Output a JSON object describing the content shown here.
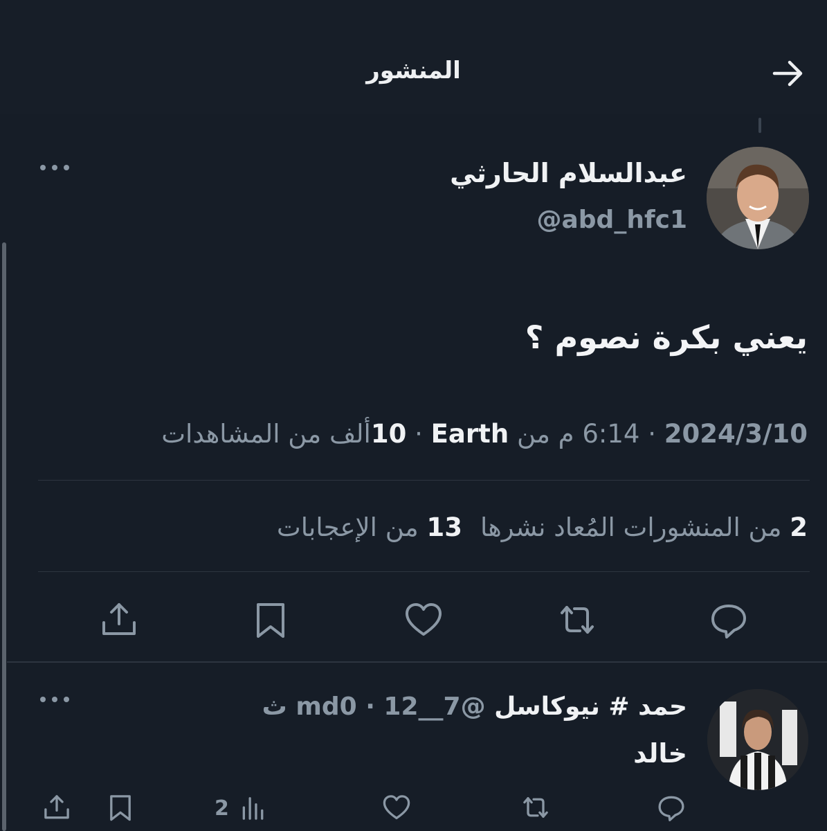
{
  "header": {
    "title": "المنشور",
    "back_icon": "arrow-right-icon"
  },
  "tweet": {
    "author_name": "عبدالسلام الحارثي",
    "author_handle": "@abd_hfc1",
    "text": "يعني بكرة نصوم ؟",
    "meta": {
      "date": "2024/3/10",
      "separator": "·",
      "time": "6:14 م من",
      "location": "Earth",
      "views_count": "10",
      "views_label": "ألف من المشاهدات"
    },
    "stats": {
      "reposts_count": "2",
      "reposts_label": "من المنشورات المُعاد نشرها",
      "likes_count": "13",
      "likes_label": "من الإعجابات"
    },
    "actions": [
      "reply-icon",
      "repost-icon",
      "like-icon",
      "bookmark-icon",
      "share-icon"
    ]
  },
  "reply": {
    "name": "حمد # نيوكاسل",
    "handle_time": "@7__md0 · 12 ث",
    "name_line2": "خالد",
    "views_count": "2"
  },
  "colors": {
    "background": "#161d27",
    "text_primary": "#e7e9ea",
    "text_secondary": "#8b98a5",
    "divider": "#2d3540"
  }
}
